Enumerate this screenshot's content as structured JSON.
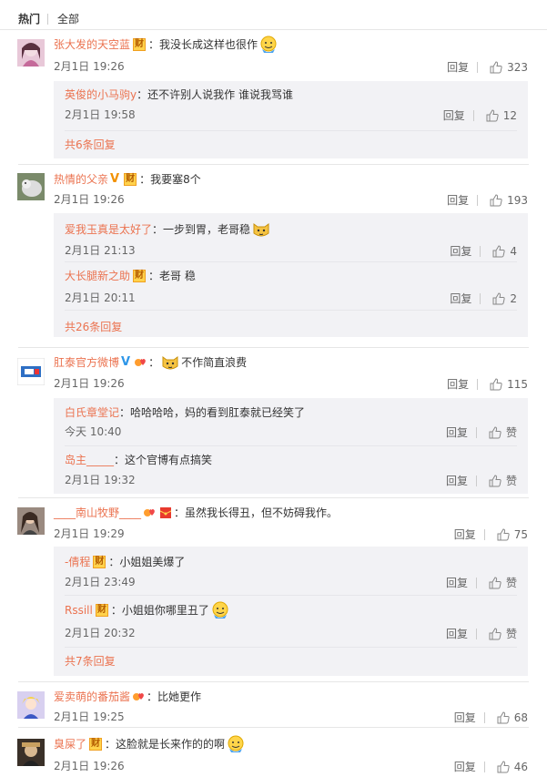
{
  "tabs": {
    "hot": "热门",
    "all": "全部"
  },
  "actions": {
    "reply": "回复",
    "like_zero": "赞"
  },
  "colors": {
    "username": "#eb7350",
    "badge_bg": "#ffd24c",
    "reply_bg": "#f2f2f5"
  },
  "comments": [
    {
      "username": "张大发的天空蓝",
      "badge": "财",
      "text": "我没长成这样也很作",
      "time": "2月1日 19:26",
      "likes": "323",
      "replies": [
        {
          "username": "英俊的小马驹y",
          "text": "还不许别人说我作 谁说我骂谁",
          "time": "2月1日 19:58",
          "likes": "12"
        }
      ],
      "more": "共6条回复"
    },
    {
      "username": "热情的父亲",
      "badge": "财",
      "text": "我要塞8个",
      "time": "2月1日 19:26",
      "likes": "193",
      "replies": [
        {
          "username": "爱我玉真是太好了",
          "text": "一步到胃，老哥稳",
          "time": "2月1日 21:13",
          "likes": "4"
        },
        {
          "username": "大长腿新之助",
          "badge": "财",
          "text": "老哥 稳",
          "time": "2月1日 20:11",
          "likes": "2"
        }
      ],
      "more": "共26条回复"
    },
    {
      "username": "肛泰官方微博",
      "text": "不作简直浪费",
      "time": "2月1日 19:26",
      "likes": "115",
      "replies": [
        {
          "username": "白氏章堂记",
          "text": "哈哈哈哈，妈的看到肛泰就已经笑了",
          "time": "今天 10:40",
          "likes": "赞"
        },
        {
          "username": "岛主_____",
          "text": "这个官博有点搞笑",
          "time": "2月1日 19:32",
          "likes": "赞"
        }
      ]
    },
    {
      "username": "____南山牧野____",
      "text": "虽然我长得丑，但不妨碍我作。",
      "time": "2月1日 19:29",
      "likes": "75",
      "replies": [
        {
          "username": "-倩程",
          "badge": "财",
          "text": "小姐姐美爆了",
          "time": "2月1日 23:49",
          "likes": "赞"
        },
        {
          "username": "Rssill",
          "badge": "财",
          "text": "小姐姐你哪里丑了",
          "time": "2月1日 20:32",
          "likes": "赞"
        }
      ],
      "more": "共7条回复"
    },
    {
      "username": "爱卖萌的番茄酱",
      "text": "比她更作",
      "time": "2月1日 19:25",
      "likes": "68"
    },
    {
      "username": "臭屎了",
      "badge": "财",
      "text": "这脸就是长来作的的啊",
      "time": "2月1日 19:26",
      "likes": "46"
    }
  ]
}
